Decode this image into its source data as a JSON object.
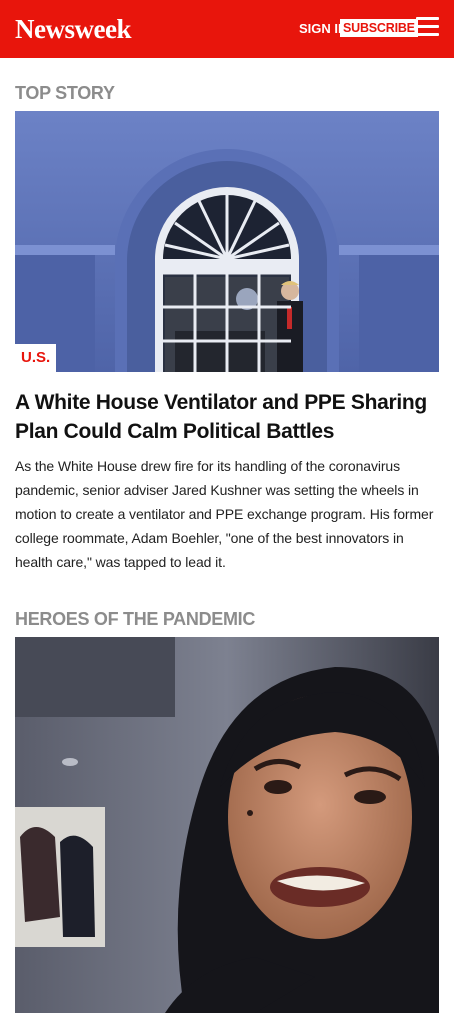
{
  "header": {
    "logo": "Newsweek",
    "sign_in": "SIGN IN",
    "subscribe": "SUBSCRIBE",
    "menu_icon": "hamburger-menu-icon"
  },
  "top_story": {
    "section_label": "TOP STORY",
    "category": "U.S.",
    "headline": "A White House Ventilator and PPE Sharing Plan Could Calm Political Battles",
    "summary": "As the White House drew fire for its handling of the coronavirus pandemic, senior adviser Jared Kushner was setting the wheels in motion to create a ventilator and PPE exchange program. His former college roommate, Adam Boehler, \"one of the best innovators in health care,\" was tapped to lead it."
  },
  "heroes": {
    "section_label": "HEROES OF THE PANDEMIC"
  },
  "colors": {
    "brand_red": "#e8150c",
    "section_gray": "#8c8c8c"
  }
}
